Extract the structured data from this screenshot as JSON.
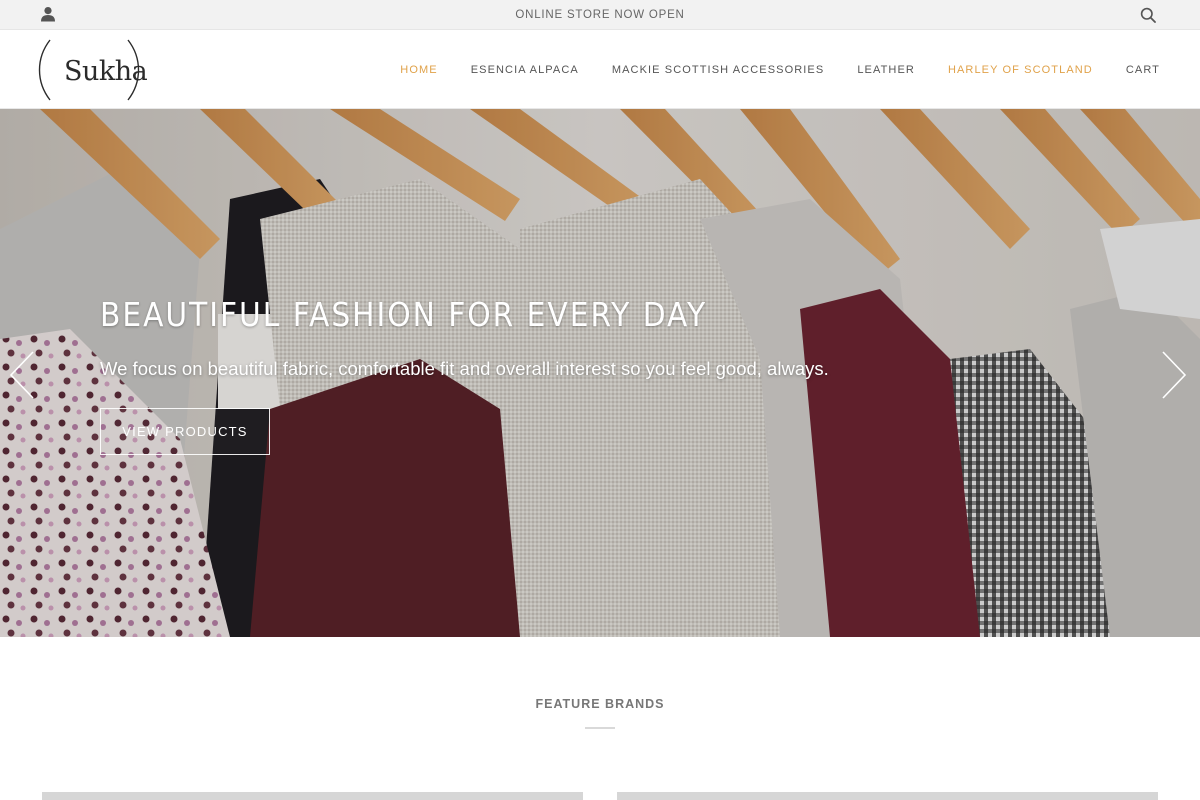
{
  "topbar": {
    "announcement": "ONLINE STORE NOW OPEN",
    "account_icon": "user-icon",
    "search_icon": "search-icon"
  },
  "header": {
    "logo_text": "Sukha",
    "nav": [
      {
        "label": "HOME",
        "active": true
      },
      {
        "label": "ESENCIA ALPACA",
        "active": false
      },
      {
        "label": "MACKIE SCOTTISH ACCESSORIES",
        "active": false
      },
      {
        "label": "LEATHER",
        "active": false
      },
      {
        "label": "HARLEY OF SCOTLAND",
        "active": true
      },
      {
        "label": "CART",
        "active": false
      }
    ]
  },
  "hero": {
    "title": "BEAUTIFUL FASHION FOR EVERY DAY",
    "subtitle": "We focus on beautiful fabric, comfortable fit and overall interest so you feel good, always.",
    "cta_label": "VIEW PRODUCTS",
    "prev_icon": "chevron-left-icon",
    "next_icon": "chevron-right-icon"
  },
  "feature": {
    "title": "FEATURE BRANDS"
  },
  "colors": {
    "accent": "#e0a24a",
    "topbar_bg": "#f2f2f2",
    "text": "#555555"
  }
}
